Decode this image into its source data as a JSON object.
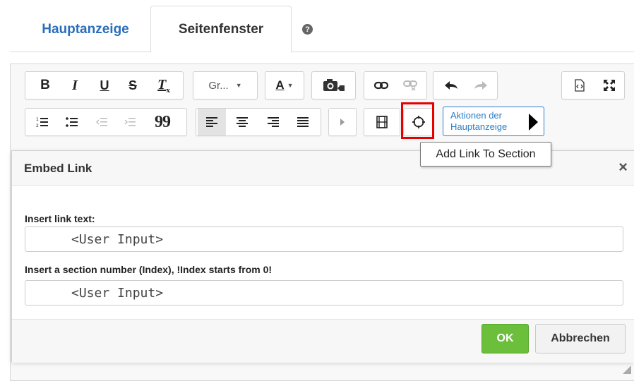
{
  "tabs": [
    {
      "label": "Hauptanzeige"
    },
    {
      "label": "Seitenfenster"
    }
  ],
  "help_icon": "question-circle-icon",
  "toolbar": {
    "bold": "B",
    "italic": "I",
    "underline": "U",
    "strike": "S",
    "remove_format": "T",
    "remove_format_sub": "x",
    "font_select": "Gr...",
    "text_color": "A",
    "numbered_list": "1≡",
    "quote": "99",
    "actions_label": "Aktionen der Hauptanzeige"
  },
  "tooltip": "Add Link To Section",
  "dialog": {
    "title": "Embed Link",
    "close": "×",
    "field1_label": "Insert link text:",
    "field1_value": "<User Input>",
    "field2_label": "Insert a section number (Index), !Index starts from 0!",
    "field2_value": "<User Input>",
    "ok": "OK",
    "cancel": "Abbrechen"
  },
  "colors": {
    "link_blue": "#2a6ebb",
    "ok_green": "#6cbf3a",
    "highlight_red": "#e60000"
  }
}
